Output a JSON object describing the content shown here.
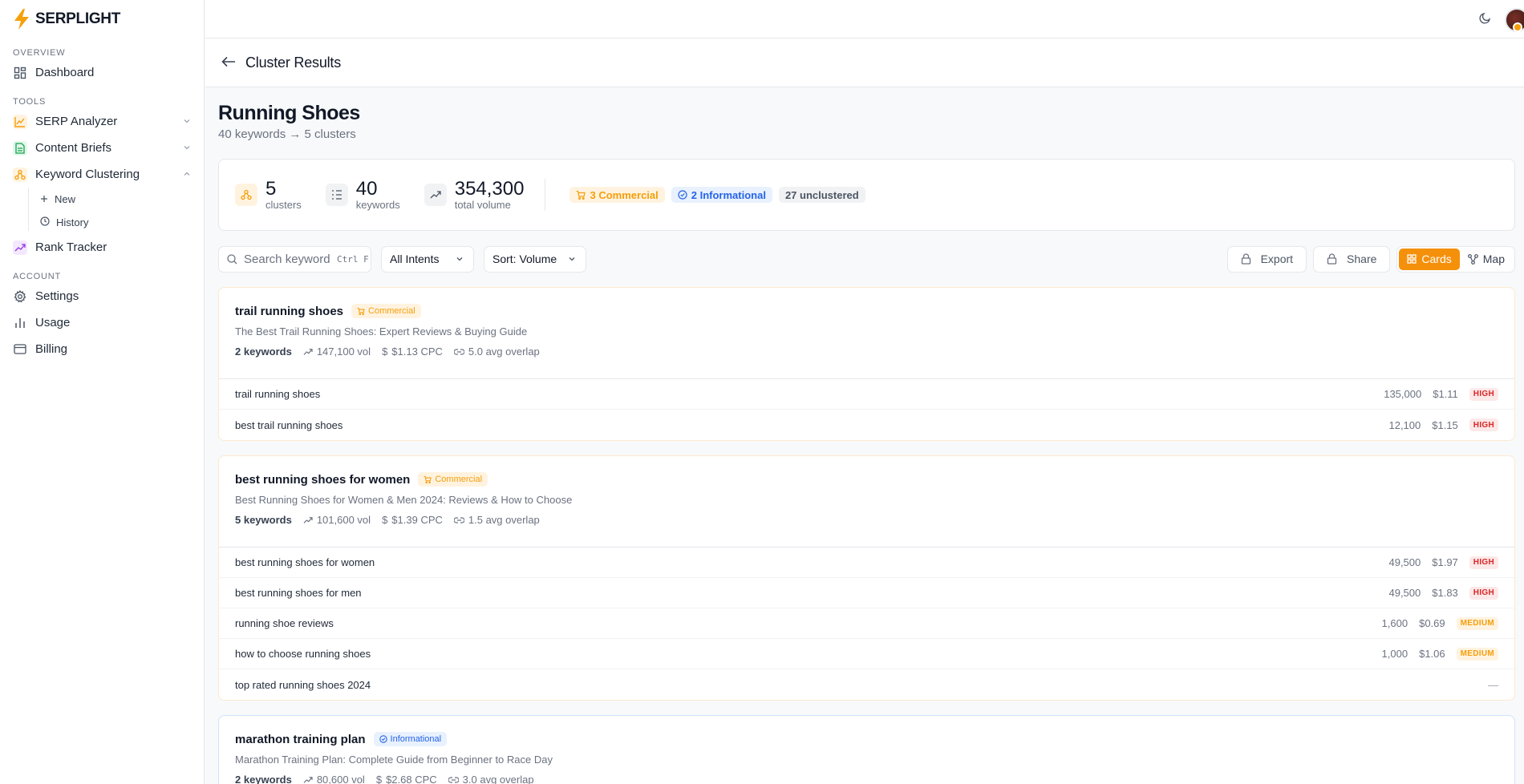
{
  "app": {
    "logo_text": "SERPLIGHT"
  },
  "sidebar": {
    "sections": [
      {
        "label": "OVERVIEW"
      },
      {
        "label": "TOOLS"
      },
      {
        "label": "ACCOUNT"
      }
    ],
    "dashboard": "Dashboard",
    "serp_analyzer": "SERP Analyzer",
    "content_briefs": "Content Briefs",
    "keyword_clustering": "Keyword Clustering",
    "kc_new": "New",
    "kc_history": "History",
    "rank_tracker": "Rank Tracker",
    "settings": "Settings",
    "usage": "Usage",
    "billing": "Billing"
  },
  "header": {
    "title": "Cluster Results"
  },
  "page": {
    "title": "Running Shoes",
    "subtitle": "40 keywords → 5 clusters"
  },
  "stats": {
    "clusters_value": "5",
    "clusters_label": "clusters",
    "keywords_value": "40",
    "keywords_label": "keywords",
    "volume_value": "354,300",
    "volume_label": "total volume",
    "commercial": "3 Commercial",
    "informational": "2 Informational",
    "unclustered": "27 unclustered"
  },
  "toolbar": {
    "search_placeholder": "Search keywords",
    "search_shortcut": "Ctrl F",
    "intent_filter": "All Intents",
    "sort": "Sort: Volume",
    "export": "Export",
    "share": "Share",
    "view_cards": "Cards",
    "view_map": "Map"
  },
  "colors": {
    "accent": "#f5900b",
    "commercial": "#f59e0b",
    "informational": "#2563eb",
    "high": "#dc2626"
  },
  "clusters": [
    {
      "title": "trail running shoes",
      "intent": "Commercial",
      "description": "The Best Trail Running Shoes: Expert Reviews & Buying Guide",
      "keywords": "2 keywords",
      "volume": "147,100 vol",
      "cpc": "$1.13 CPC",
      "overlap": "5.0 avg overlap",
      "rows": [
        {
          "keyword": "trail running shoes",
          "volume": "135,000",
          "cpc": "$1.11",
          "competition": "HIGH"
        },
        {
          "keyword": "best trail running shoes",
          "volume": "12,100",
          "cpc": "$1.15",
          "competition": "HIGH"
        }
      ]
    },
    {
      "title": "best running shoes for women",
      "intent": "Commercial",
      "description": "Best Running Shoes for Women & Men 2024: Reviews & How to Choose",
      "keywords": "5 keywords",
      "volume": "101,600 vol",
      "cpc": "$1.39 CPC",
      "overlap": "1.5 avg overlap",
      "rows": [
        {
          "keyword": "best running shoes for women",
          "volume": "49,500",
          "cpc": "$1.97",
          "competition": "HIGH"
        },
        {
          "keyword": "best running shoes for men",
          "volume": "49,500",
          "cpc": "$1.83",
          "competition": "HIGH"
        },
        {
          "keyword": "running shoe reviews",
          "volume": "1,600",
          "cpc": "$0.69",
          "competition": "MEDIUM"
        },
        {
          "keyword": "how to choose running shoes",
          "volume": "1,000",
          "cpc": "$1.06",
          "competition": "MEDIUM"
        },
        {
          "keyword": "top rated running shoes 2024",
          "volume": "",
          "cpc": "",
          "competition": "—"
        }
      ]
    },
    {
      "title": "marathon training plan",
      "intent": "Informational",
      "description": "Marathon Training Plan: Complete Guide from Beginner to Race Day",
      "keywords": "2 keywords",
      "volume": "80,600 vol",
      "cpc": "$2.68 CPC",
      "overlap": "3.0 avg overlap"
    }
  ]
}
